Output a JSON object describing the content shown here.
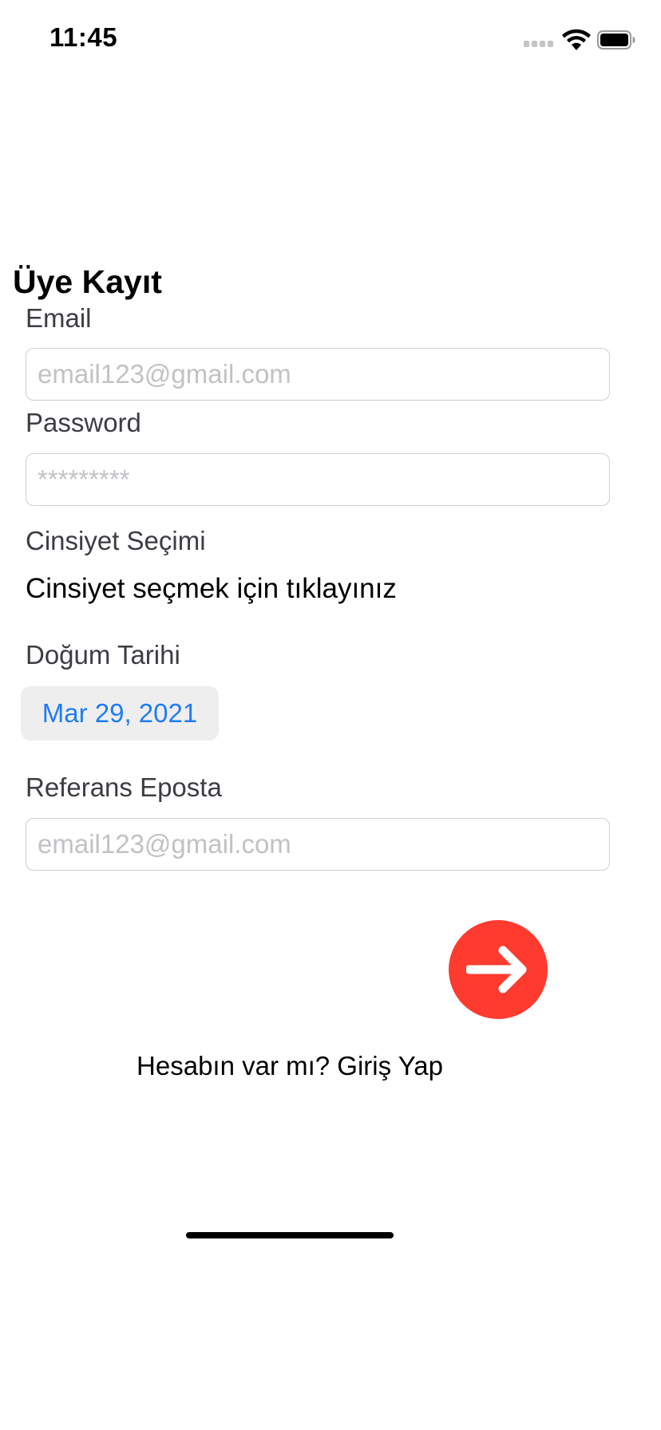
{
  "status_bar": {
    "time": "11:45"
  },
  "form": {
    "title": "Üye Kayıt",
    "email": {
      "label": "Email",
      "placeholder": "email123@gmail.com",
      "value": ""
    },
    "password": {
      "label": "Password",
      "placeholder": "*********",
      "value": ""
    },
    "gender": {
      "label": "Cinsiyet Seçimi",
      "prompt": "Cinsiyet seçmek için tıklayınız"
    },
    "birth_date": {
      "label": "Doğum Tarihi",
      "value": "Mar 29, 2021"
    },
    "referral_email": {
      "label": "Referans Eposta",
      "placeholder": "email123@gmail.com",
      "value": ""
    }
  },
  "footer": {
    "login_link": "Hesabın var mı? Giriş Yap"
  },
  "colors": {
    "accent": "#1f7cf2",
    "submit_button": "#ff3b30",
    "date_pill_bg": "#eeeeef",
    "placeholder": "#c2c2c6"
  },
  "icons": {
    "submit": "arrow-right-icon",
    "wifi": "wifi-icon",
    "battery": "battery-icon",
    "signal": "cellular-signal-icon"
  }
}
